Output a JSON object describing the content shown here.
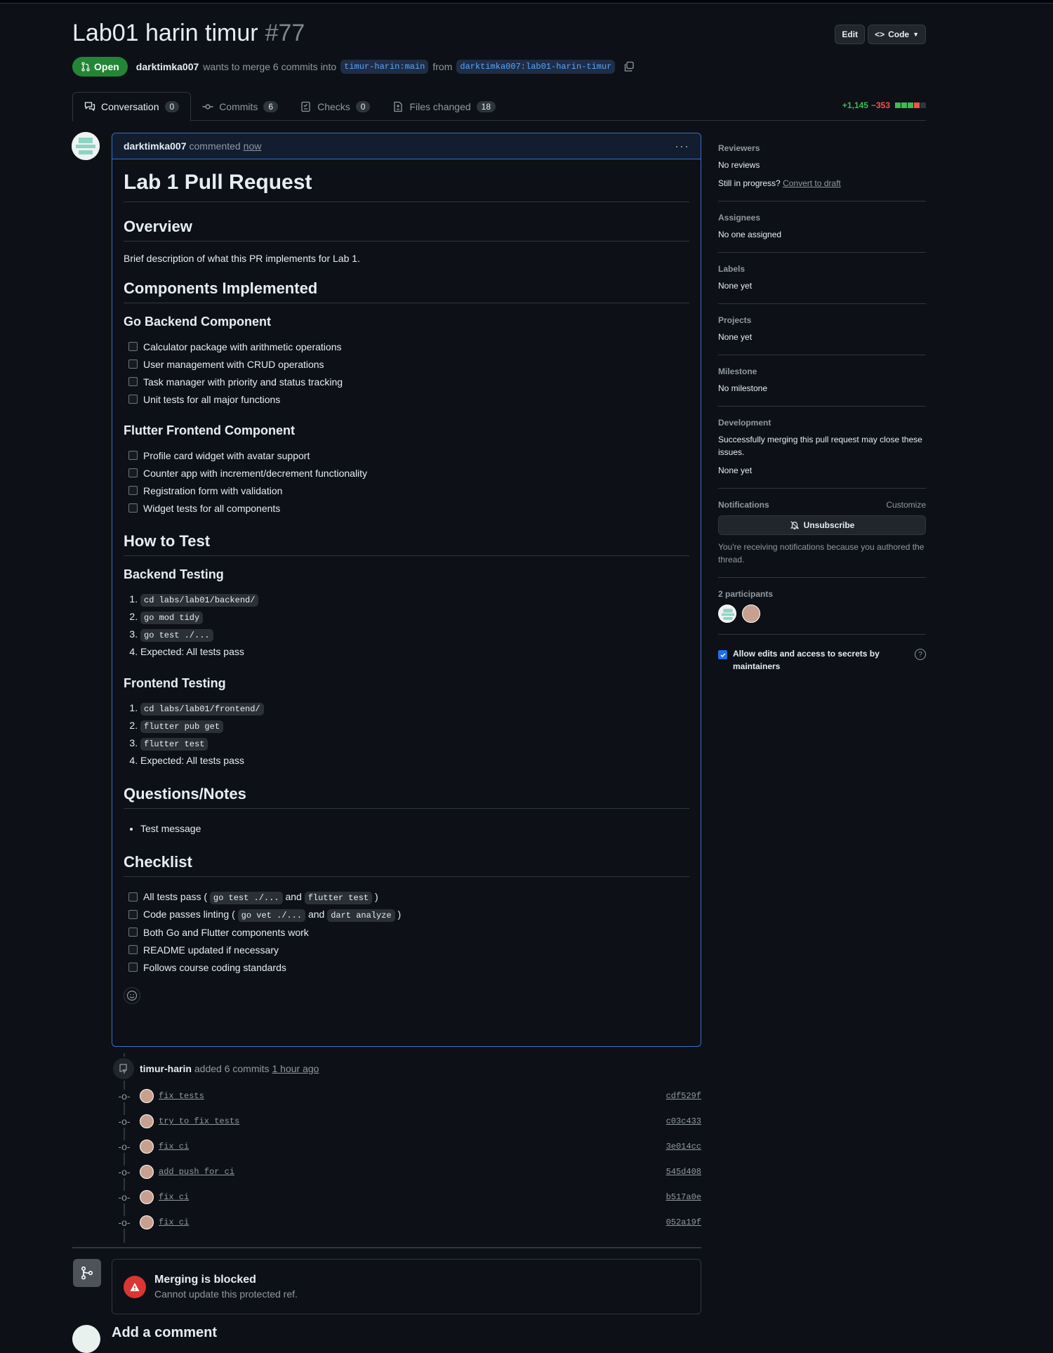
{
  "header": {
    "title": "Lab01 harin timur",
    "number": "#77",
    "edit_label": "Edit",
    "code_label": "Code",
    "state": "Open",
    "author": "darktimka007",
    "merge_text": "wants to merge 6 commits into",
    "base_branch": "timur-harin:main",
    "from_text": "from",
    "head_branch": "darktimka007:lab01-harin-timur"
  },
  "tabs": [
    {
      "label": "Conversation",
      "count": "0"
    },
    {
      "label": "Commits",
      "count": "6"
    },
    {
      "label": "Checks",
      "count": "0"
    },
    {
      "label": "Files changed",
      "count": "18"
    }
  ],
  "diffstat": {
    "additions": "+1,145",
    "deletions": "−353"
  },
  "comment": {
    "author": "darktimka007",
    "action": "commented",
    "time": "now",
    "h1": "Lab 1 Pull Request",
    "overview_h": "Overview",
    "overview_p": "Brief description of what this PR implements for Lab 1.",
    "components_h": "Components Implemented",
    "go_h": "Go Backend Component",
    "go_tasks": [
      "Calculator package with arithmetic operations",
      "User management with CRUD operations",
      "Task manager with priority and status tracking",
      "Unit tests for all major functions"
    ],
    "flutter_h": "Flutter Frontend Component",
    "flutter_tasks": [
      "Profile card widget with avatar support",
      "Counter app with increment/decrement functionality",
      "Registration form with validation",
      "Widget tests for all components"
    ],
    "howto_h": "How to Test",
    "backend_h": "Backend Testing",
    "backend_steps": [
      "cd labs/lab01/backend/",
      "go mod tidy",
      "go test ./...",
      "Expected: All tests pass"
    ],
    "frontend_h": "Frontend Testing",
    "frontend_steps": [
      "cd labs/lab01/frontend/",
      "flutter pub get",
      "flutter test",
      "Expected: All tests pass"
    ],
    "notes_h": "Questions/Notes",
    "notes": [
      "Test message"
    ],
    "checklist_h": "Checklist",
    "checklist": {
      "c1_pre": "All tests pass (",
      "c1_code1": "go test ./...",
      "c1_mid": "and",
      "c1_code2": "flutter test",
      "c1_post": ")",
      "c2_pre": "Code passes linting (",
      "c2_code1": "go vet ./...",
      "c2_mid": "and",
      "c2_code2": "dart analyze",
      "c2_post": ")",
      "c3": "Both Go and Flutter components work",
      "c4": "README updated if necessary",
      "c5": "Follows course coding standards"
    }
  },
  "timeline": {
    "actor": "timur-harin",
    "action": "added 6 commits",
    "time": "1 hour ago",
    "commits": [
      {
        "msg": "fix tests",
        "sha": "cdf529f"
      },
      {
        "msg": "try to fix tests",
        "sha": "c03c433"
      },
      {
        "msg": "fix ci",
        "sha": "3e014cc"
      },
      {
        "msg": "add push for ci",
        "sha": "545d408"
      },
      {
        "msg": "fix ci",
        "sha": "b517a0e"
      },
      {
        "msg": "fix ci",
        "sha": "052a19f"
      }
    ]
  },
  "merge": {
    "title": "Merging is blocked",
    "subtitle": "Cannot update this protected ref."
  },
  "add_comment": "Add a comment",
  "sidebar": {
    "reviewers_h": "Reviewers",
    "reviewers_v": "No reviews",
    "draft_q": "Still in progress?",
    "draft_link": "Convert to draft",
    "assignees_h": "Assignees",
    "assignees_v": "No one assigned",
    "labels_h": "Labels",
    "labels_v": "None yet",
    "projects_h": "Projects",
    "projects_v": "None yet",
    "milestone_h": "Milestone",
    "milestone_v": "No milestone",
    "development_h": "Development",
    "development_text": "Successfully merging this pull request may close these issues.",
    "development_v": "None yet",
    "notifications_h": "Notifications",
    "customize": "Customize",
    "unsubscribe": "Unsubscribe",
    "notif_reason": "You're receiving notifications because you authored the thread.",
    "participants_h": "2 participants",
    "allow_edits": "Allow edits and access to secrets by maintainers",
    "help": "?"
  },
  "colors": {
    "open": "#238636",
    "link": "#58a6ff",
    "add": "#3fb950",
    "del": "#f85149",
    "blocked": "#da3633"
  }
}
